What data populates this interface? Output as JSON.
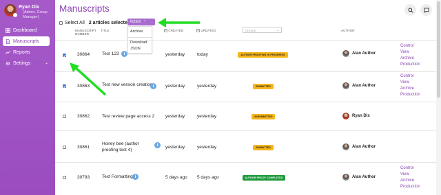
{
  "user": {
    "name": "Ryan Dix",
    "role": "(Admin, Group Manager)"
  },
  "sidebar": {
    "items": [
      {
        "label": "Dashboard",
        "icon": "dashboard-icon",
        "active": false
      },
      {
        "label": "Manuscripts",
        "icon": "document-icon",
        "active": true
      },
      {
        "label": "Reports",
        "icon": "chart-line-icon",
        "active": false
      },
      {
        "label": "Settings",
        "icon": "gear-icon",
        "active": false
      }
    ]
  },
  "page": {
    "title": "Manuscripts"
  },
  "toolbar": {
    "select_all": "Select All",
    "selected_count": "2 articles selected",
    "action_label": "Action",
    "action_menu": [
      "Archive",
      "Download",
      "JSON"
    ]
  },
  "table": {
    "headers": {
      "number": "MANUSCRIPT NUMBER",
      "title": "TITLE",
      "created": "CREATED",
      "updated": "UPDATED",
      "status": "STATUS",
      "author": "AUTHOR"
    },
    "rows": [
      {
        "checked": true,
        "number": "30864",
        "title": "Test 123",
        "created": "yesterday",
        "updated": "today",
        "status": "AUTHOR PROOFING IN PROGRESS",
        "status_color": "#f5b51b",
        "author": "Alan Author",
        "links": [
          "Control",
          "View",
          "Archive",
          "Production"
        ]
      },
      {
        "checked": true,
        "number": "30863",
        "title": "Test new version creation",
        "created": "yesterday",
        "updated": "yesterday",
        "status": "SUBMITTED",
        "status_color": "#f5b51b",
        "author": "Alan Author",
        "links": [
          "Control",
          "View",
          "Archive",
          "Production"
        ]
      },
      {
        "checked": false,
        "number": "30862",
        "title": "Test review page access 2",
        "created": "yesterday",
        "updated": "yesterday",
        "status": "UNSUBMITTED",
        "status_color": "#f5b51b",
        "author": "Ryan Dix",
        "links": [
          "Control",
          "View",
          "Archive",
          "Production"
        ]
      },
      {
        "checked": false,
        "number": "30861",
        "title": "Honey bee (author proofing test 4)",
        "created": "yesterday",
        "updated": "yesterday",
        "status": "SUBMITTED",
        "status_color": "#f5b51b",
        "author": "Alan Author",
        "links": [
          "Control",
          "View",
          "Archive",
          "Production"
        ]
      },
      {
        "checked": false,
        "number": "30793",
        "title": "Text Formatting",
        "created": "5 days ago",
        "updated": "5 days ago",
        "status": "AUTHOR PROOF COMPLETED",
        "status_color": "#1e9a3a",
        "author": "Alan Author",
        "links": [
          "Control",
          "View",
          "Archive",
          "Production"
        ]
      }
    ]
  },
  "colors": {
    "brand": "#9b4dc0",
    "link": "#8d44b7",
    "annotation_arrow": "#22dd22"
  }
}
